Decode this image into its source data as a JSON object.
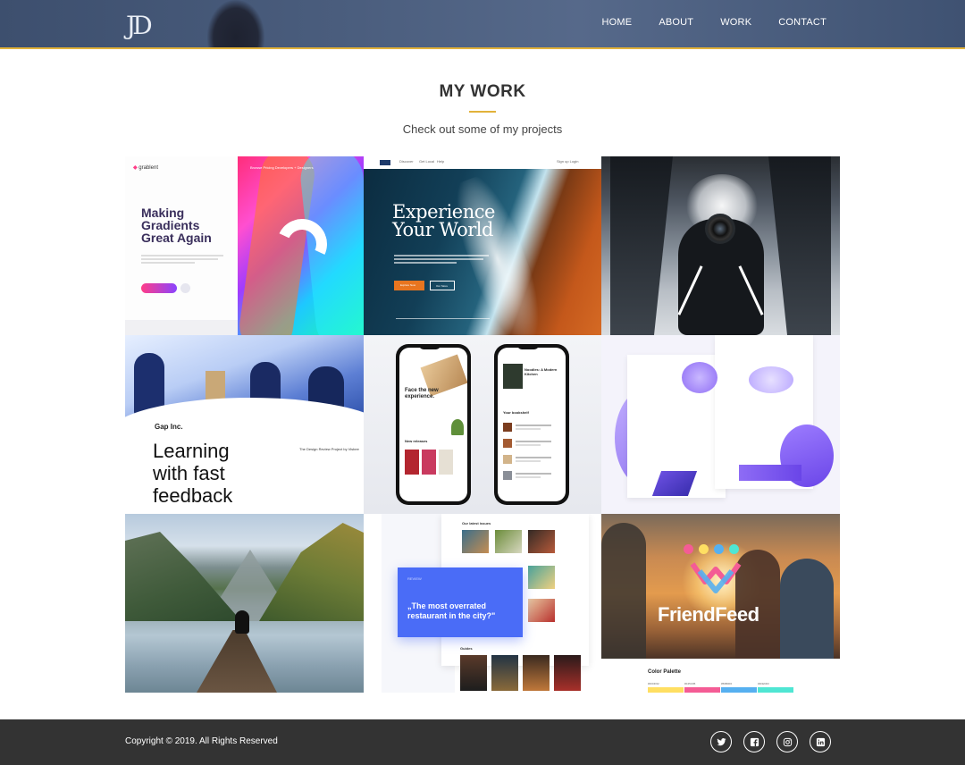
{
  "header": {
    "logo_text": "JD",
    "nav": [
      "HOME",
      "ABOUT",
      "WORK",
      "CONTACT"
    ],
    "accent_color": "#e2b23a"
  },
  "section": {
    "title": "MY WORK",
    "subtitle": "Check out some of my projects"
  },
  "projects": [
    {
      "name": "grablent",
      "brand": "grablent",
      "headline_lines": [
        "Making",
        "Gradients",
        "Great Again"
      ],
      "nav_text": "Browse   Pricing   Developers   + Designers"
    },
    {
      "name": "experience",
      "nav_items": [
        "Discover",
        "Get Local",
        "Help"
      ],
      "nav_right": "Sign up    Login",
      "headline_lines": [
        "Experience",
        "Your World"
      ],
      "button_primary": "Explore Now",
      "button_secondary": "Our Store"
    },
    {
      "name": "photographer-escalator"
    },
    {
      "name": "gap-inc",
      "company": "Gap Inc.",
      "headline_lines": [
        "Learning",
        "with fast",
        "feedback"
      ],
      "note": "The Design Review Project by Visbee"
    },
    {
      "name": "book-app",
      "left_title_lines": [
        "Face the new",
        "experience."
      ],
      "left_section": "New releases",
      "right_title_lines": [
        "Noodles: A Modern",
        "Kitchen"
      ],
      "right_section": "Your bookshelf"
    },
    {
      "name": "purple-illustrations"
    },
    {
      "name": "mountain-lake"
    },
    {
      "name": "restaurant-review",
      "top_label": "Our latest issues",
      "card_small": "REVIEW",
      "card_quote": "„The most overrated restaurant in the city?\"",
      "bottom_label": "Guides"
    },
    {
      "name": "friendfeed",
      "brand": "FriendFeed",
      "palette_title": "Color Palette",
      "swatches": [
        {
          "label": "#FFDF62",
          "color": "#ffdf62"
        },
        {
          "label": "#F45C95",
          "color": "#f45c95"
        },
        {
          "label": "#56B0F0",
          "color": "#56b0f0"
        },
        {
          "label": "#4FE6D3",
          "color": "#4fe6d3"
        }
      ],
      "dot_colors": [
        "#f45c95",
        "#ffdf62",
        "#56b0f0",
        "#4fe6d3"
      ]
    }
  ],
  "footer": {
    "copyright": "Copyright © 2019. All Rights Reserved",
    "socials": [
      "twitter-icon",
      "facebook-icon",
      "instagram-icon",
      "linkedin-icon"
    ]
  }
}
